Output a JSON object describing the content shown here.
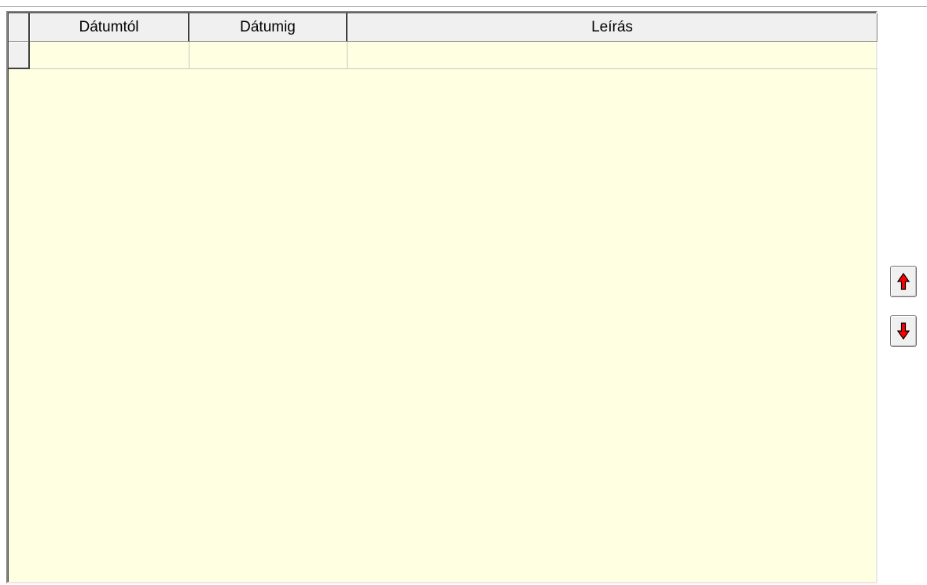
{
  "grid": {
    "columns": [
      {
        "label": "Dátumtól"
      },
      {
        "label": "Dátumig"
      },
      {
        "label": "Leírás"
      }
    ],
    "rows": [
      {
        "cells": [
          "",
          "",
          ""
        ]
      }
    ]
  },
  "buttons": {
    "move_up_icon": "arrow-up-icon",
    "move_down_icon": "arrow-down-icon"
  },
  "colors": {
    "grid_background": "#ffffe1",
    "arrow_red": "#ff0000"
  }
}
